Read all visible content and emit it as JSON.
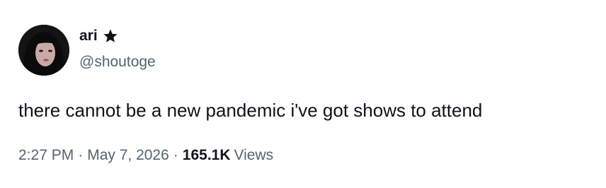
{
  "author": {
    "display_name": "ari",
    "handle": "@shoutoge",
    "badge_icon": "star-icon",
    "avatar_icon": "avatar-photo"
  },
  "tweet": {
    "text": "there cannot be a new pandemic i've got shows to attend"
  },
  "meta": {
    "time": "2:27 PM",
    "separator": "·",
    "date": "May 7, 2026",
    "views_count": "165.1K",
    "views_label": "Views"
  },
  "colors": {
    "primary_text": "#0f1419",
    "secondary_text": "#536471",
    "background": "#ffffff"
  }
}
